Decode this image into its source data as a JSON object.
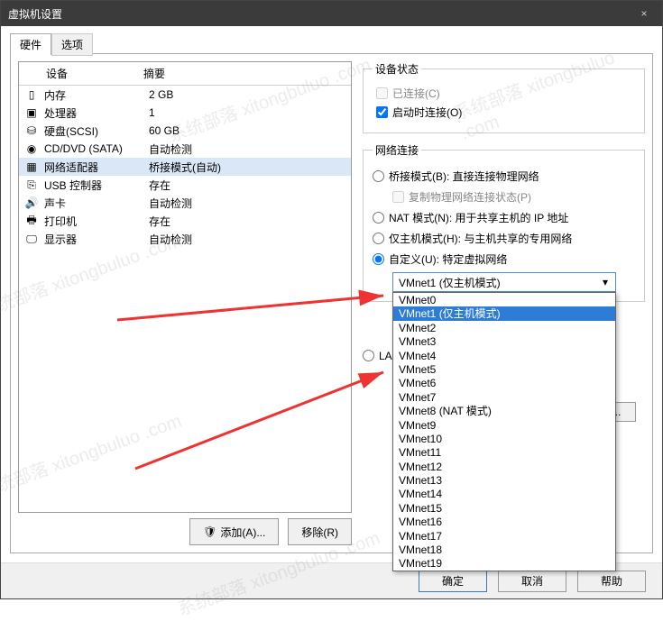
{
  "window": {
    "title": "虚拟机设置",
    "close": "×"
  },
  "tabs": {
    "hardware": "硬件",
    "options": "选项"
  },
  "header": {
    "device": "设备",
    "summary": "摘要"
  },
  "devices": [
    {
      "icon": "memory-icon",
      "name": "内存",
      "summary": "2 GB"
    },
    {
      "icon": "cpu-icon",
      "name": "处理器",
      "summary": "1"
    },
    {
      "icon": "hdd-icon",
      "name": "硬盘(SCSI)",
      "summary": "60 GB"
    },
    {
      "icon": "cd-icon",
      "name": "CD/DVD (SATA)",
      "summary": "自动检测"
    },
    {
      "icon": "net-icon",
      "name": "网络适配器",
      "summary": "桥接模式(自动)"
    },
    {
      "icon": "usb-icon",
      "name": "USB 控制器",
      "summary": "存在"
    },
    {
      "icon": "sound-icon",
      "name": "声卡",
      "summary": "自动检测"
    },
    {
      "icon": "printer-icon",
      "name": "打印机",
      "summary": "存在"
    },
    {
      "icon": "display-icon",
      "name": "显示器",
      "summary": "自动检测"
    }
  ],
  "selectedDevice": 4,
  "buttons": {
    "add": "添加(A)...",
    "remove": "移除(R)"
  },
  "status": {
    "legend": "设备状态",
    "connected": "已连接(C)",
    "connectOnStart": "启动时连接(O)"
  },
  "net": {
    "legend": "网络连接",
    "bridged": "桥接模式(B): 直接连接物理网络",
    "replicate": "复制物理网络连接状态(P)",
    "nat": "NAT 模式(N): 用于共享主机的 IP 地址",
    "hostonly": "仅主机模式(H): 与主机共享的专用网络",
    "custom": "自定义(U): 特定虚拟网络",
    "lan": "LAN 区段(L):",
    "lanbtn": "LAN 区段(S)..."
  },
  "dropdown": {
    "selected": "VMnet1 (仅主机模式)",
    "options": [
      "VMnet0",
      "VMnet1 (仅主机模式)",
      "VMnet2",
      "VMnet3",
      "VMnet4",
      "VMnet5",
      "VMnet6",
      "VMnet7",
      "VMnet8 (NAT 模式)",
      "VMnet9",
      "VMnet10",
      "VMnet11",
      "VMnet12",
      "VMnet13",
      "VMnet14",
      "VMnet15",
      "VMnet16",
      "VMnet17",
      "VMnet18",
      "VMnet19"
    ],
    "highlightIndex": 1
  },
  "footer": {
    "ok": "确定",
    "cancel": "取消",
    "help": "帮助"
  },
  "watermark": "系统部落 xitongbuluo .com",
  "icons": {
    "memory": "▯",
    "cpu": "▣",
    "hdd": "⛁",
    "cd": "◉",
    "net": "▦",
    "usb": "⎘",
    "sound": "🔊",
    "printer": "🖶",
    "display": "🖵",
    "shield": "🛡",
    "chevron": "▾"
  }
}
